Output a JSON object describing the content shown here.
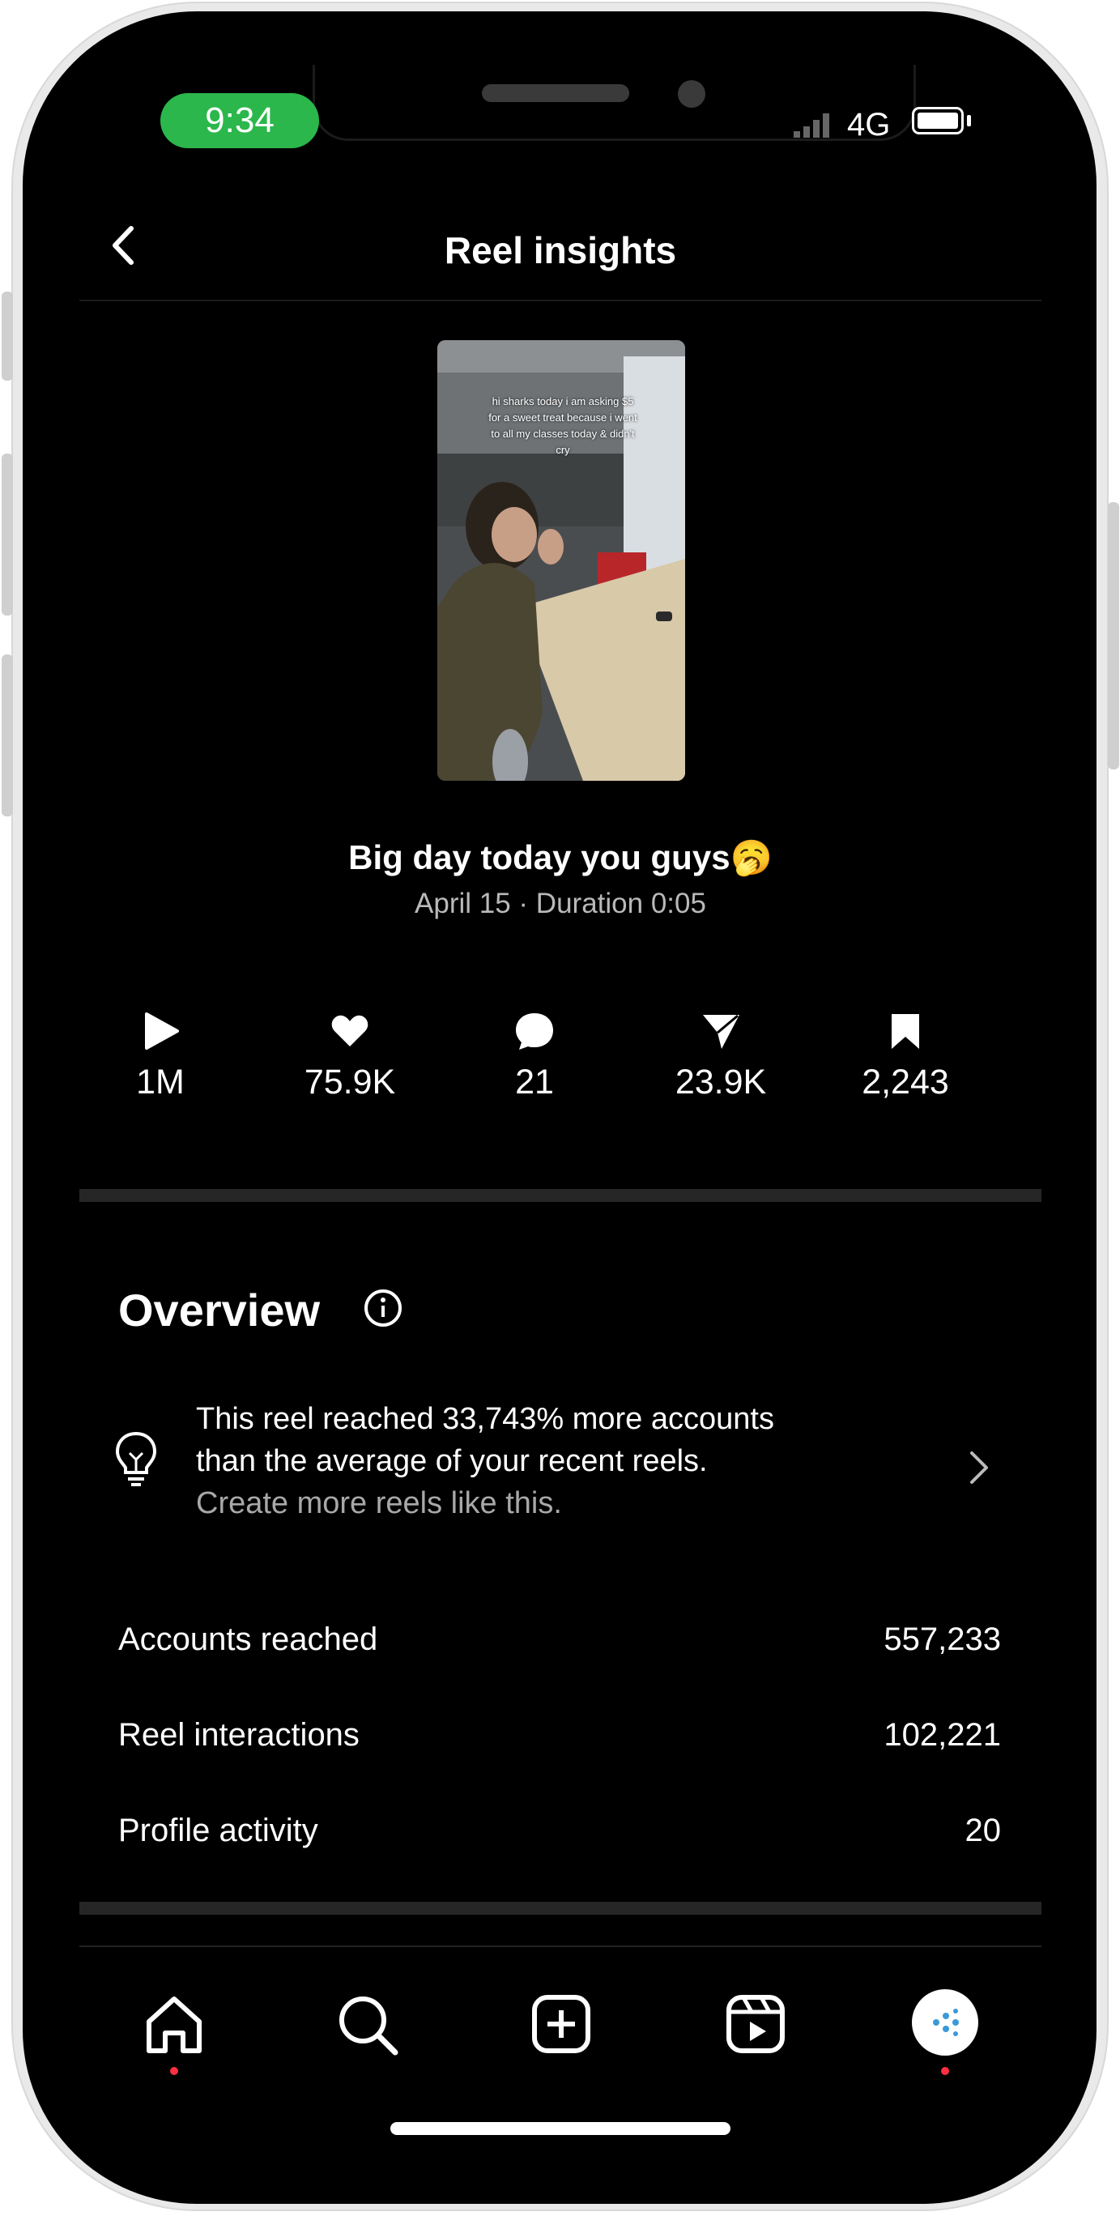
{
  "status_bar": {
    "time": "9:34",
    "network": "4G"
  },
  "header": {
    "title": "Reel insights",
    "back_icon": "chevron-left-icon"
  },
  "reel": {
    "thumbnail_overlay_text": "hi sharks today i am asking $5 for a sweet treat because i went to all my classes today & didn't cry",
    "caption": "Big day today you guys🥱",
    "meta": "April 15 · Duration 0:05"
  },
  "stats": [
    {
      "icon": "play-icon",
      "value": "1M"
    },
    {
      "icon": "heart-icon",
      "value": "75.9K"
    },
    {
      "icon": "comment-icon",
      "value": "21"
    },
    {
      "icon": "share-icon",
      "value": "23.9K"
    },
    {
      "icon": "bookmark-icon",
      "value": "2,243"
    }
  ],
  "overview": {
    "title": "Overview",
    "info_icon": "info-icon",
    "tip": {
      "icon": "lightbulb-icon",
      "line1": "This reel reached 33,743% more accounts",
      "line2": "than the average of your recent reels.",
      "sub": "Create more reels like this."
    },
    "rows": [
      {
        "label": "Accounts reached",
        "value": "557,233"
      },
      {
        "label": "Reel interactions",
        "value": "102,221"
      },
      {
        "label": "Profile activity",
        "value": "20"
      }
    ]
  },
  "nav": {
    "items": [
      "home-icon",
      "search-icon",
      "create-icon",
      "reels-icon",
      "profile-avatar"
    ]
  },
  "colors": {
    "status_green": "#2bb74b",
    "notification_dot": "#ff3040",
    "background": "#000000"
  }
}
